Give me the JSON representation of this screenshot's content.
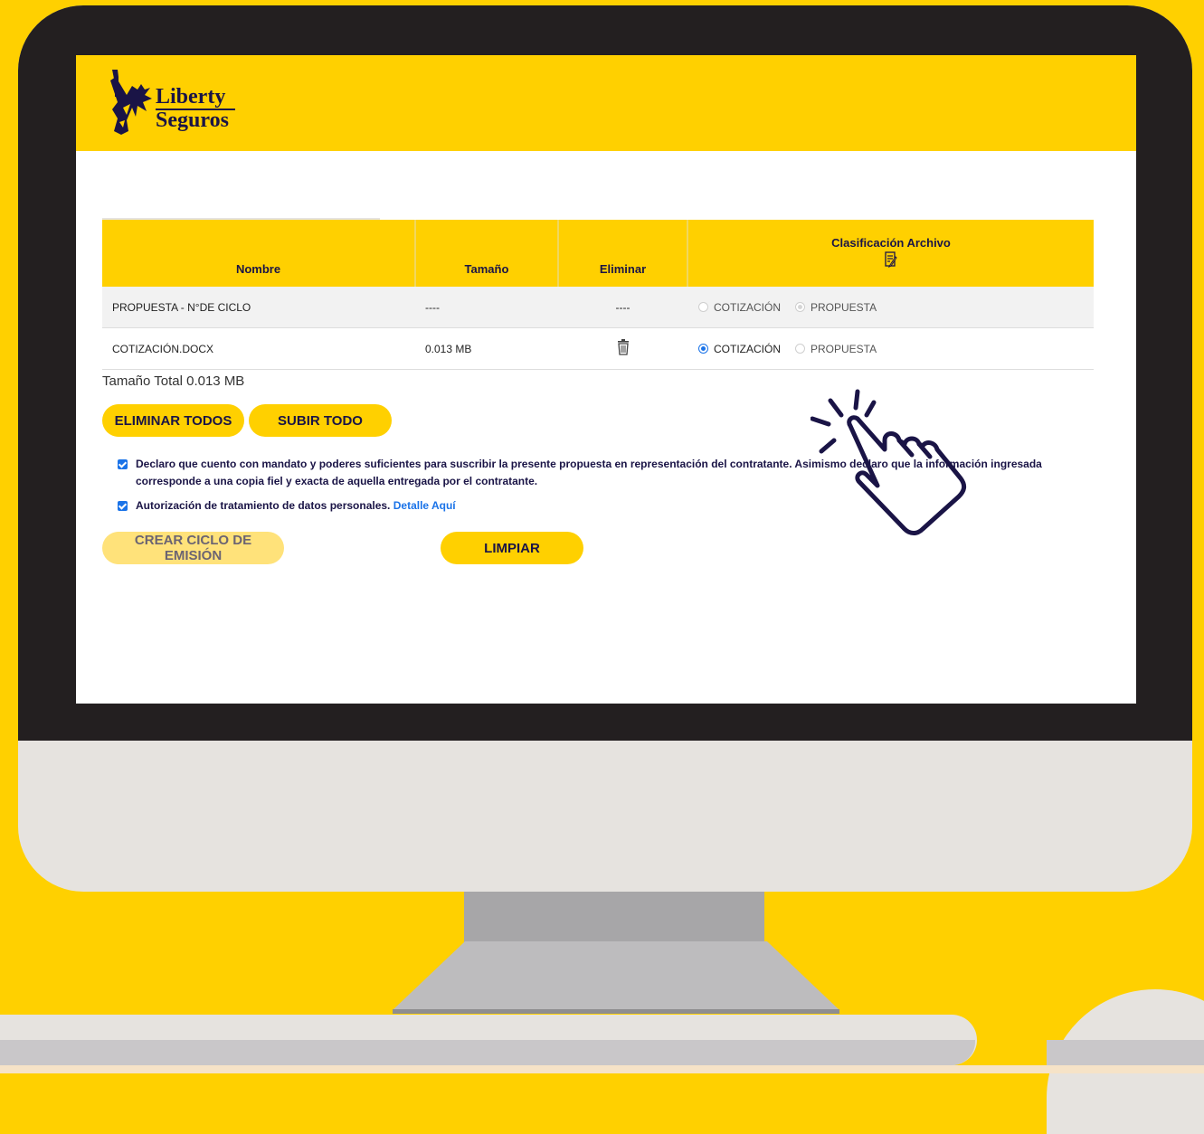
{
  "brand": {
    "line1": "Liberty",
    "line2": "Seguros",
    "primary_color": "#FFD000",
    "navy": "#1A1446"
  },
  "table": {
    "headers": {
      "name": "Nombre",
      "size": "Tamaño",
      "delete": "Eliminar",
      "classification": "Clasificación Archivo"
    },
    "rows": [
      {
        "name": "PROPUESTA - N°DE CICLO",
        "size": "----",
        "delete": "----",
        "options": [
          "COTIZACIÓN",
          "PROPUESTA"
        ],
        "selected": "PROPUESTA",
        "disabled": true
      },
      {
        "name": "COTIZACIÓN.DOCX",
        "size": "0.013 MB",
        "delete": "trash-icon",
        "options": [
          "COTIZACIÓN",
          "PROPUESTA"
        ],
        "selected": "COTIZACIÓN",
        "disabled": false
      }
    ]
  },
  "total_size": "Tamaño Total 0.013 MB",
  "buttons": {
    "delete_all": "ELIMINAR TODOS",
    "upload_all": "SUBIR TODO",
    "create_cycle": "CREAR CICLO DE EMISIÓN",
    "clear": "LIMPIAR"
  },
  "declarations": {
    "mandate": "Declaro que cuento con mandato y poderes suficientes para suscribir la presente propuesta en representación del contratante. Asimismo declaro que la información ingresada corresponde a una copia fiel y exacta de aquella entregada por el contratante.",
    "privacy": "Autorización de tratamiento de datos personales.",
    "privacy_link": "Detalle Aquí"
  },
  "icons": [
    "statue-of-liberty-logo",
    "edit-note-icon",
    "trash-icon",
    "pointing-hand-icon"
  ]
}
